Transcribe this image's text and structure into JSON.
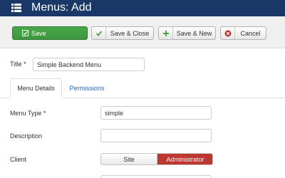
{
  "header": {
    "title": "Menus: Add",
    "background": "#1a3867",
    "icon": "list-icon"
  },
  "toolbar": {
    "save_label": "Save",
    "save_close_label": "Save & Close",
    "save_new_label": "Save & New",
    "cancel_label": "Cancel",
    "save_color": "#46a546",
    "cancel_icon_color": "#bd362f",
    "icons": {
      "save": "save-icon",
      "save_close": "check-icon",
      "save_new": "plus-icon",
      "cancel": "cancel-icon"
    }
  },
  "form": {
    "title_label": "Title *",
    "title_value": "Simple Backend Menu",
    "tabs": [
      {
        "label": "Menu Details",
        "active": true
      },
      {
        "label": "Permissions",
        "active": false
      }
    ],
    "menu_type_label": "Menu Type *",
    "menu_type_value": "simple",
    "description_label": "Description",
    "description_value": "",
    "client_label": "Client",
    "client_options": [
      {
        "label": "Site",
        "selected": false
      },
      {
        "label": "Administrator",
        "selected": true
      }
    ],
    "client_selected_color": "#bd362f"
  }
}
